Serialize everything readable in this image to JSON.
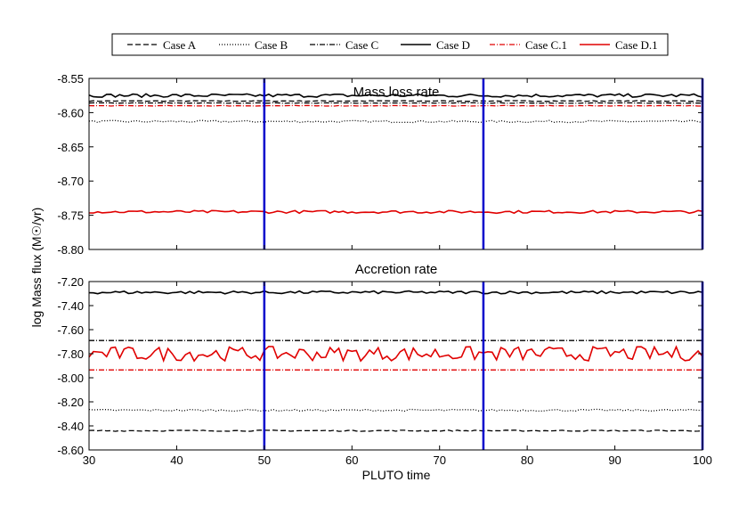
{
  "chart_data": [
    {
      "type": "line",
      "title": "Mass loss rate",
      "xlabel": "PLUTO time",
      "ylabel": "log Mass flux (M☉/yr)",
      "xlim": [
        30,
        100
      ],
      "ylim": [
        -8.8,
        -8.55
      ],
      "yticks": [
        "-8.55",
        "-8.60",
        "-8.65",
        "-8.70",
        "-8.75",
        "-8.80"
      ],
      "xticks": [
        "30",
        "40",
        "50",
        "60",
        "70",
        "80",
        "90",
        "100"
      ],
      "vlines": [
        50,
        75,
        100
      ],
      "vline_color": "#0000cc",
      "legend_position": "top",
      "series": [
        {
          "name": "Case A",
          "color": "#000000",
          "style": "dashed",
          "approx_value": -8.583,
          "noise": 0.0006
        },
        {
          "name": "Case B",
          "color": "#000000",
          "style": "dotted",
          "approx_value": -8.613,
          "noise": 0.0015
        },
        {
          "name": "Case C",
          "color": "#000000",
          "style": "dashdot",
          "approx_value": -8.586,
          "noise": 0.0004
        },
        {
          "name": "Case D",
          "color": "#000000",
          "style": "solid",
          "approx_value": -8.575,
          "noise": 0.0025
        },
        {
          "name": "Case C.1",
          "color": "#e00000",
          "style": "dashdot",
          "approx_value": -8.59,
          "noise": 0.0004
        },
        {
          "name": "Case D.1",
          "color": "#e00000",
          "style": "solid",
          "approx_value": -8.745,
          "noise": 0.002
        }
      ]
    },
    {
      "type": "line",
      "title": "Accretion rate",
      "xlabel": "PLUTO time",
      "ylabel": "log Mass flux (M☉/yr)",
      "xlim": [
        30,
        100
      ],
      "ylim": [
        -8.6,
        -7.2
      ],
      "yticks": [
        "-7.20",
        "-7.40",
        "-7.60",
        "-7.80",
        "-8.00",
        "-8.20",
        "-8.40",
        "-8.60"
      ],
      "xticks": [
        "30",
        "40",
        "50",
        "60",
        "70",
        "80",
        "90",
        "100"
      ],
      "vlines": [
        50,
        75,
        100
      ],
      "vline_color": "#0000cc",
      "series": [
        {
          "name": "Case A",
          "color": "#000000",
          "style": "dashed",
          "approx_value": -8.44,
          "noise": 0.005
        },
        {
          "name": "Case B",
          "color": "#000000",
          "style": "dotted",
          "approx_value": -8.27,
          "noise": 0.008
        },
        {
          "name": "Case C",
          "color": "#000000",
          "style": "dashdot",
          "approx_value": -7.69,
          "noise": 0.0
        },
        {
          "name": "Case D",
          "color": "#000000",
          "style": "solid",
          "approx_value": -7.29,
          "noise": 0.012
        },
        {
          "name": "Case C.1",
          "color": "#e00000",
          "style": "dashdot",
          "approx_value": -7.935,
          "noise": 0.0
        },
        {
          "name": "Case D.1",
          "color": "#e00000",
          "style": "solid",
          "approx_value": -7.8,
          "noise": 0.06
        }
      ]
    }
  ]
}
